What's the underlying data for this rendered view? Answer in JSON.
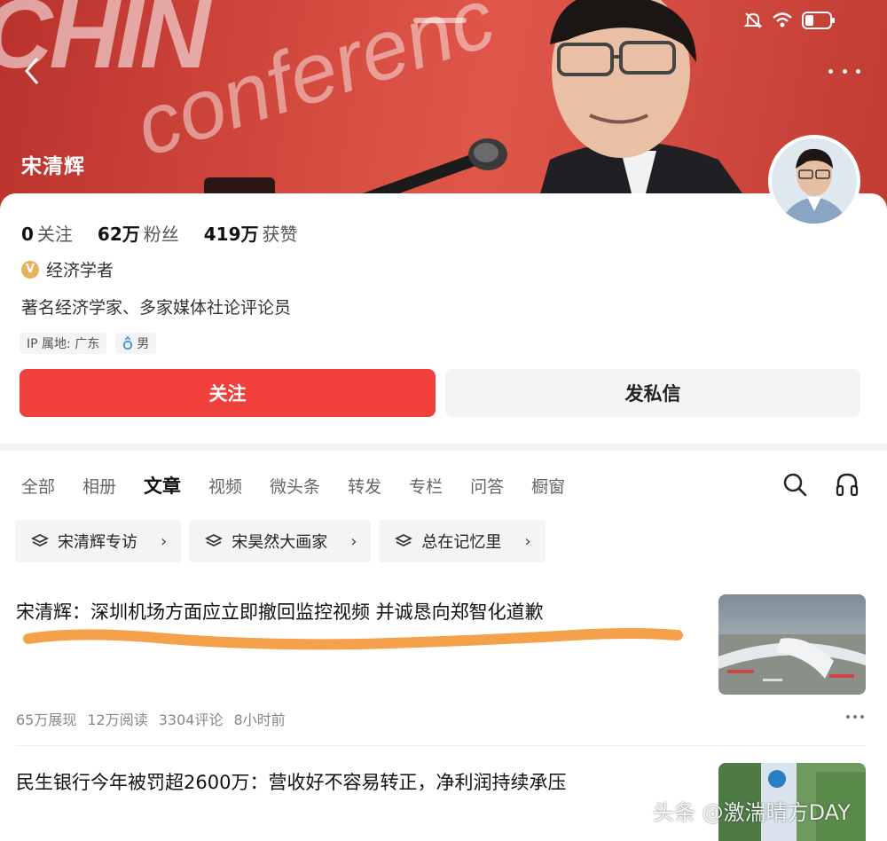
{
  "profile": {
    "name": "宋清辉",
    "stats": [
      {
        "value": "0",
        "label": "关注"
      },
      {
        "value": "62万",
        "label": "粉丝"
      },
      {
        "value": "419万",
        "label": "获赞"
      }
    ],
    "verify_badge": "V",
    "verify_text": "经济学者",
    "bio": "著名经济学家、多家媒体社论评论员",
    "tags": {
      "ip": "IP 属地: 广东",
      "gender": "男"
    },
    "follow_label": "关注",
    "message_label": "发私信"
  },
  "hero": {
    "bg_text_1": "CHIN",
    "bg_text_2": "conferenc"
  },
  "tabs": [
    "全部",
    "相册",
    "文章",
    "视频",
    "微头条",
    "转发",
    "专栏",
    "问答",
    "橱窗"
  ],
  "active_tab": "文章",
  "chips": [
    "宋清辉专访",
    "宋昊然大画家",
    "总在记忆里"
  ],
  "articles": [
    {
      "title": "宋清辉：深圳机场方面应立即撤回监控视频 并诚恳向郑智化道歉",
      "meta": {
        "views": "65万展现",
        "reads": "12万阅读",
        "comments": "3304评论",
        "time": "8小时前"
      }
    },
    {
      "title": "民生银行今年被罚超2600万：营收好不容易转正，净利润持续承压"
    }
  ],
  "watermark": "头条 @激湍晴方DAY",
  "colors": {
    "accent": "#f1403c",
    "hero": "#d44a3f",
    "scribble": "#f5a04a"
  }
}
